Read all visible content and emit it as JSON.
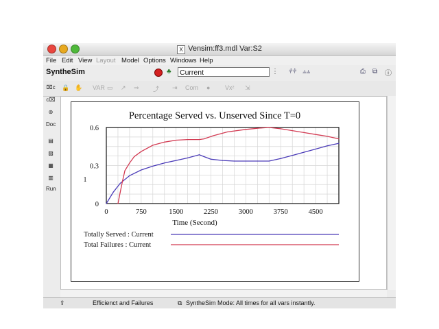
{
  "window": {
    "title": "Vensim:ff3.mdl Var:S2"
  },
  "menu": [
    "File",
    "Edit",
    "View",
    "Layout",
    "Model",
    "Options",
    "Windows",
    "Help"
  ],
  "toolbar": {
    "brand": "SyntheSim",
    "run_name": "Current"
  },
  "left_tools": [
    "Doc",
    "Run"
  ],
  "status": {
    "left_text": "Efficienct and Failures",
    "right_text": "SyntheSim Mode: All times for all vars instantly."
  },
  "chart_data": {
    "type": "line",
    "title": "Percentage Served vs. Unserved Since T=0",
    "xlabel": "Time (Second)",
    "ylabel": "1",
    "xlim": [
      0,
      5000
    ],
    "ylim": [
      0,
      0.6
    ],
    "xticks": [
      "0",
      "750",
      "1500",
      "2250",
      "3000",
      "3750",
      "4500"
    ],
    "yticks": [
      "0",
      "0.3",
      "0.6"
    ],
    "grid": true,
    "legend_position": "bottom",
    "series": [
      {
        "name": "Totally Served : Current",
        "color": "#4a3bb8",
        "x": [
          0,
          150,
          300,
          500,
          750,
          1000,
          1250,
          1500,
          1750,
          2000,
          2100,
          2250,
          2500,
          2750,
          3000,
          3250,
          3500,
          3750,
          4000,
          4250,
          4500,
          4750,
          5000
        ],
        "y": [
          0,
          0.09,
          0.16,
          0.22,
          0.265,
          0.295,
          0.32,
          0.34,
          0.36,
          0.385,
          0.37,
          0.35,
          0.34,
          0.335,
          0.335,
          0.335,
          0.335,
          0.355,
          0.38,
          0.405,
          0.43,
          0.455,
          0.475
        ]
      },
      {
        "name": "Total Failures : Current",
        "color": "#d23a52",
        "x": [
          250,
          300,
          350,
          400,
          500,
          600,
          750,
          1000,
          1250,
          1500,
          1750,
          2000,
          2100,
          2300,
          2600,
          3000,
          3300,
          3500,
          3750,
          4000,
          4250,
          4500,
          4750,
          5000
        ],
        "y": [
          0,
          0.09,
          0.18,
          0.26,
          0.32,
          0.37,
          0.41,
          0.46,
          0.485,
          0.5,
          0.505,
          0.505,
          0.51,
          0.535,
          0.565,
          0.585,
          0.595,
          0.6,
          0.59,
          0.575,
          0.56,
          0.545,
          0.53,
          0.51
        ]
      }
    ]
  }
}
